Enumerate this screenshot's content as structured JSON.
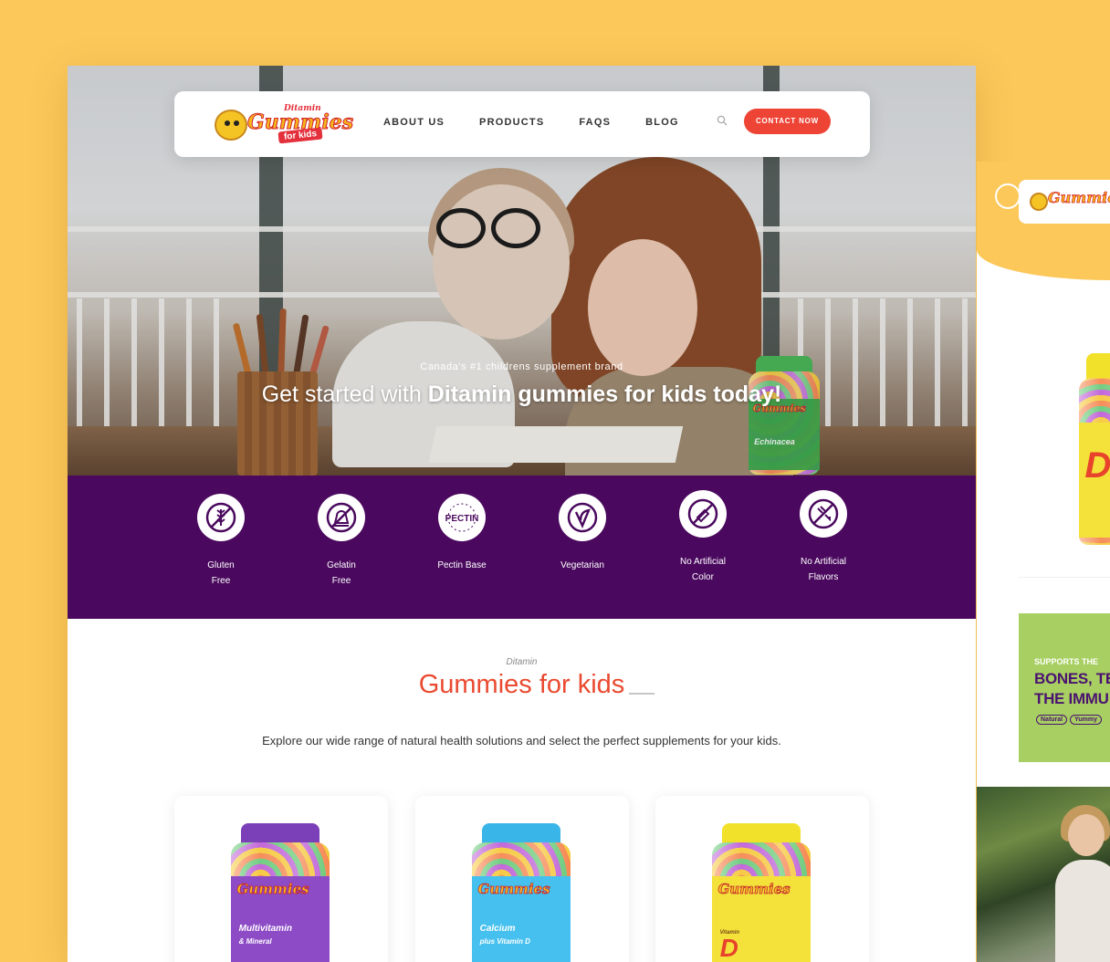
{
  "nav": {
    "logo_small": "Ditamin",
    "logo_main": "Gummies",
    "logo_kids": "for kids",
    "links": [
      "ABOUT US",
      "PRODUCTS",
      "FAQS",
      "BLOG"
    ],
    "contact_label": "CONTACT NOW"
  },
  "hero": {
    "kicker": "Canada's #1 childrens supplement brand",
    "title_prefix": "Get started with ",
    "title_bold": "Ditamin gummies for kids today!",
    "jar_name": "Echinacea"
  },
  "features": [
    {
      "line1": "Gluten",
      "line2": "Free",
      "icon": "gluten-free-icon"
    },
    {
      "line1": "Gelatin",
      "line2": "Free",
      "icon": "gelatin-free-icon"
    },
    {
      "line1": "Pectin Base",
      "line2": "",
      "icon": "pectin-icon"
    },
    {
      "line1": "Vegetarian",
      "line2": "",
      "icon": "vegetarian-icon"
    },
    {
      "line1": "No Artificial",
      "line2": "Color",
      "icon": "no-artificial-color-icon"
    },
    {
      "line1": "No Artificial",
      "line2": "Flavors",
      "icon": "no-artificial-flavors-icon"
    }
  ],
  "section": {
    "kicker": "Ditamin",
    "title": "Gummies for kids",
    "description": "Explore our wide range of natural health solutions and select the perfect supplements for your kids."
  },
  "products": [
    {
      "name": "Multivitamin",
      "subname": "& Mineral",
      "lid_color": "#7b3fb8",
      "label_color": "#8d4bc6",
      "name_color": "#ffffff"
    },
    {
      "name": "Calcium",
      "subname": "plus Vitamin D",
      "lid_color": "#39b5e8",
      "label_color": "#46c0ee",
      "name_color": "#ffffff"
    },
    {
      "name": "D",
      "subname": "Vitamin",
      "lid_color": "#f2e12a",
      "label_color": "#f4e23a",
      "name_color": "#e8442c"
    }
  ],
  "side": {
    "promo_kicker": "SUPPORTS THE",
    "promo_line1": "BONES, TE",
    "promo_line2": "THE IMMU",
    "tags": [
      "Natural",
      "Yummy"
    ]
  },
  "colors": {
    "background": "#fcc85a",
    "accent": "#ee4435",
    "purple": "#4a095e",
    "title_orange": "#ea4a30"
  }
}
